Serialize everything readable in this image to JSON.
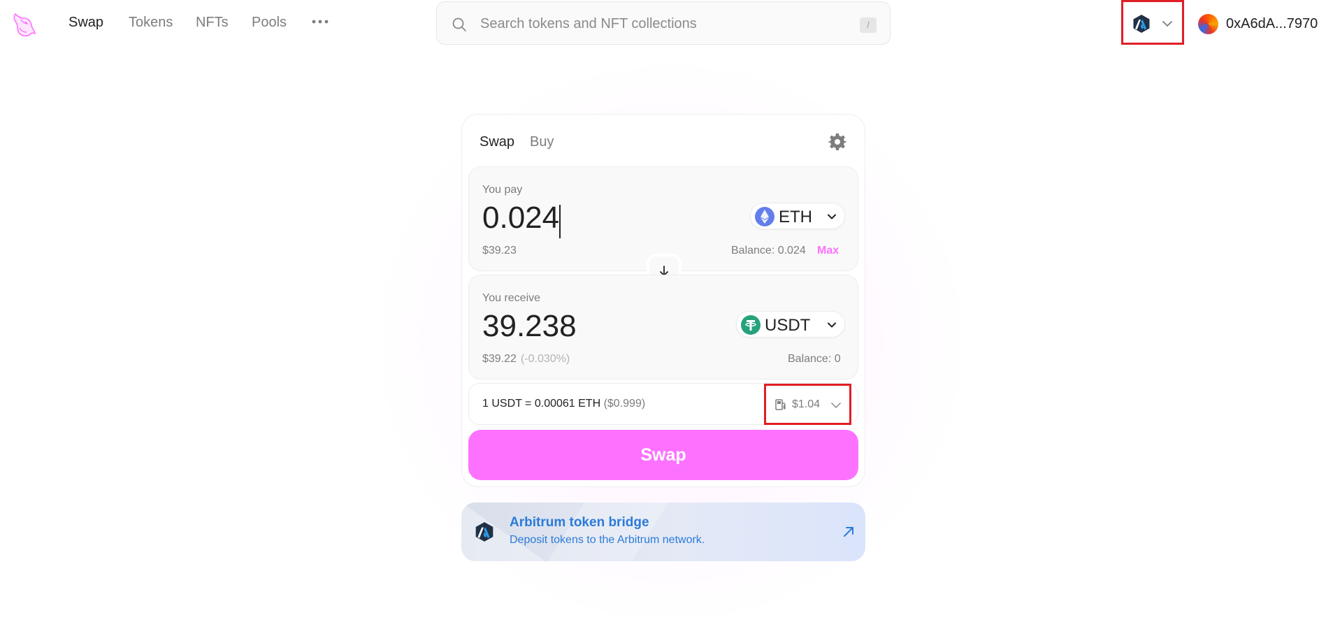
{
  "nav": {
    "links": [
      "Swap",
      "Tokens",
      "NFTs",
      "Pools"
    ],
    "more_icon": "ellipsis-icon",
    "logo_icon": "uniswap-unicorn-icon"
  },
  "search": {
    "placeholder": "Search tokens and NFT collections",
    "shortcut": "/"
  },
  "network": {
    "icon": "arbitrum-icon"
  },
  "wallet": {
    "address": "0xA6dA...7970"
  },
  "card": {
    "tabs": [
      "Swap",
      "Buy"
    ],
    "pay": {
      "label": "You pay",
      "amount": "0.024",
      "token": "ETH",
      "usd": "$39.23",
      "balance": "Balance: 0.024",
      "max": "Max"
    },
    "receive": {
      "label": "You receive",
      "amount": "39.238",
      "token": "USDT",
      "usd": "$39.22",
      "usd_change": "(-0.030%)",
      "balance": "Balance: 0"
    },
    "rate": {
      "text": "1 USDT = 0.00061 ETH",
      "usd": "($0.999)"
    },
    "gas": "$1.04",
    "swap_button": "Swap"
  },
  "bridge": {
    "title": "Arbitrum token bridge",
    "subtitle": "Deposit tokens to the Arbitrum network."
  },
  "colors": {
    "accent": "#fc72ff",
    "highlight_box": "#e01e25",
    "bridge_text": "#2b7bd8",
    "eth": "#627eea",
    "usdt": "#26a17b"
  }
}
